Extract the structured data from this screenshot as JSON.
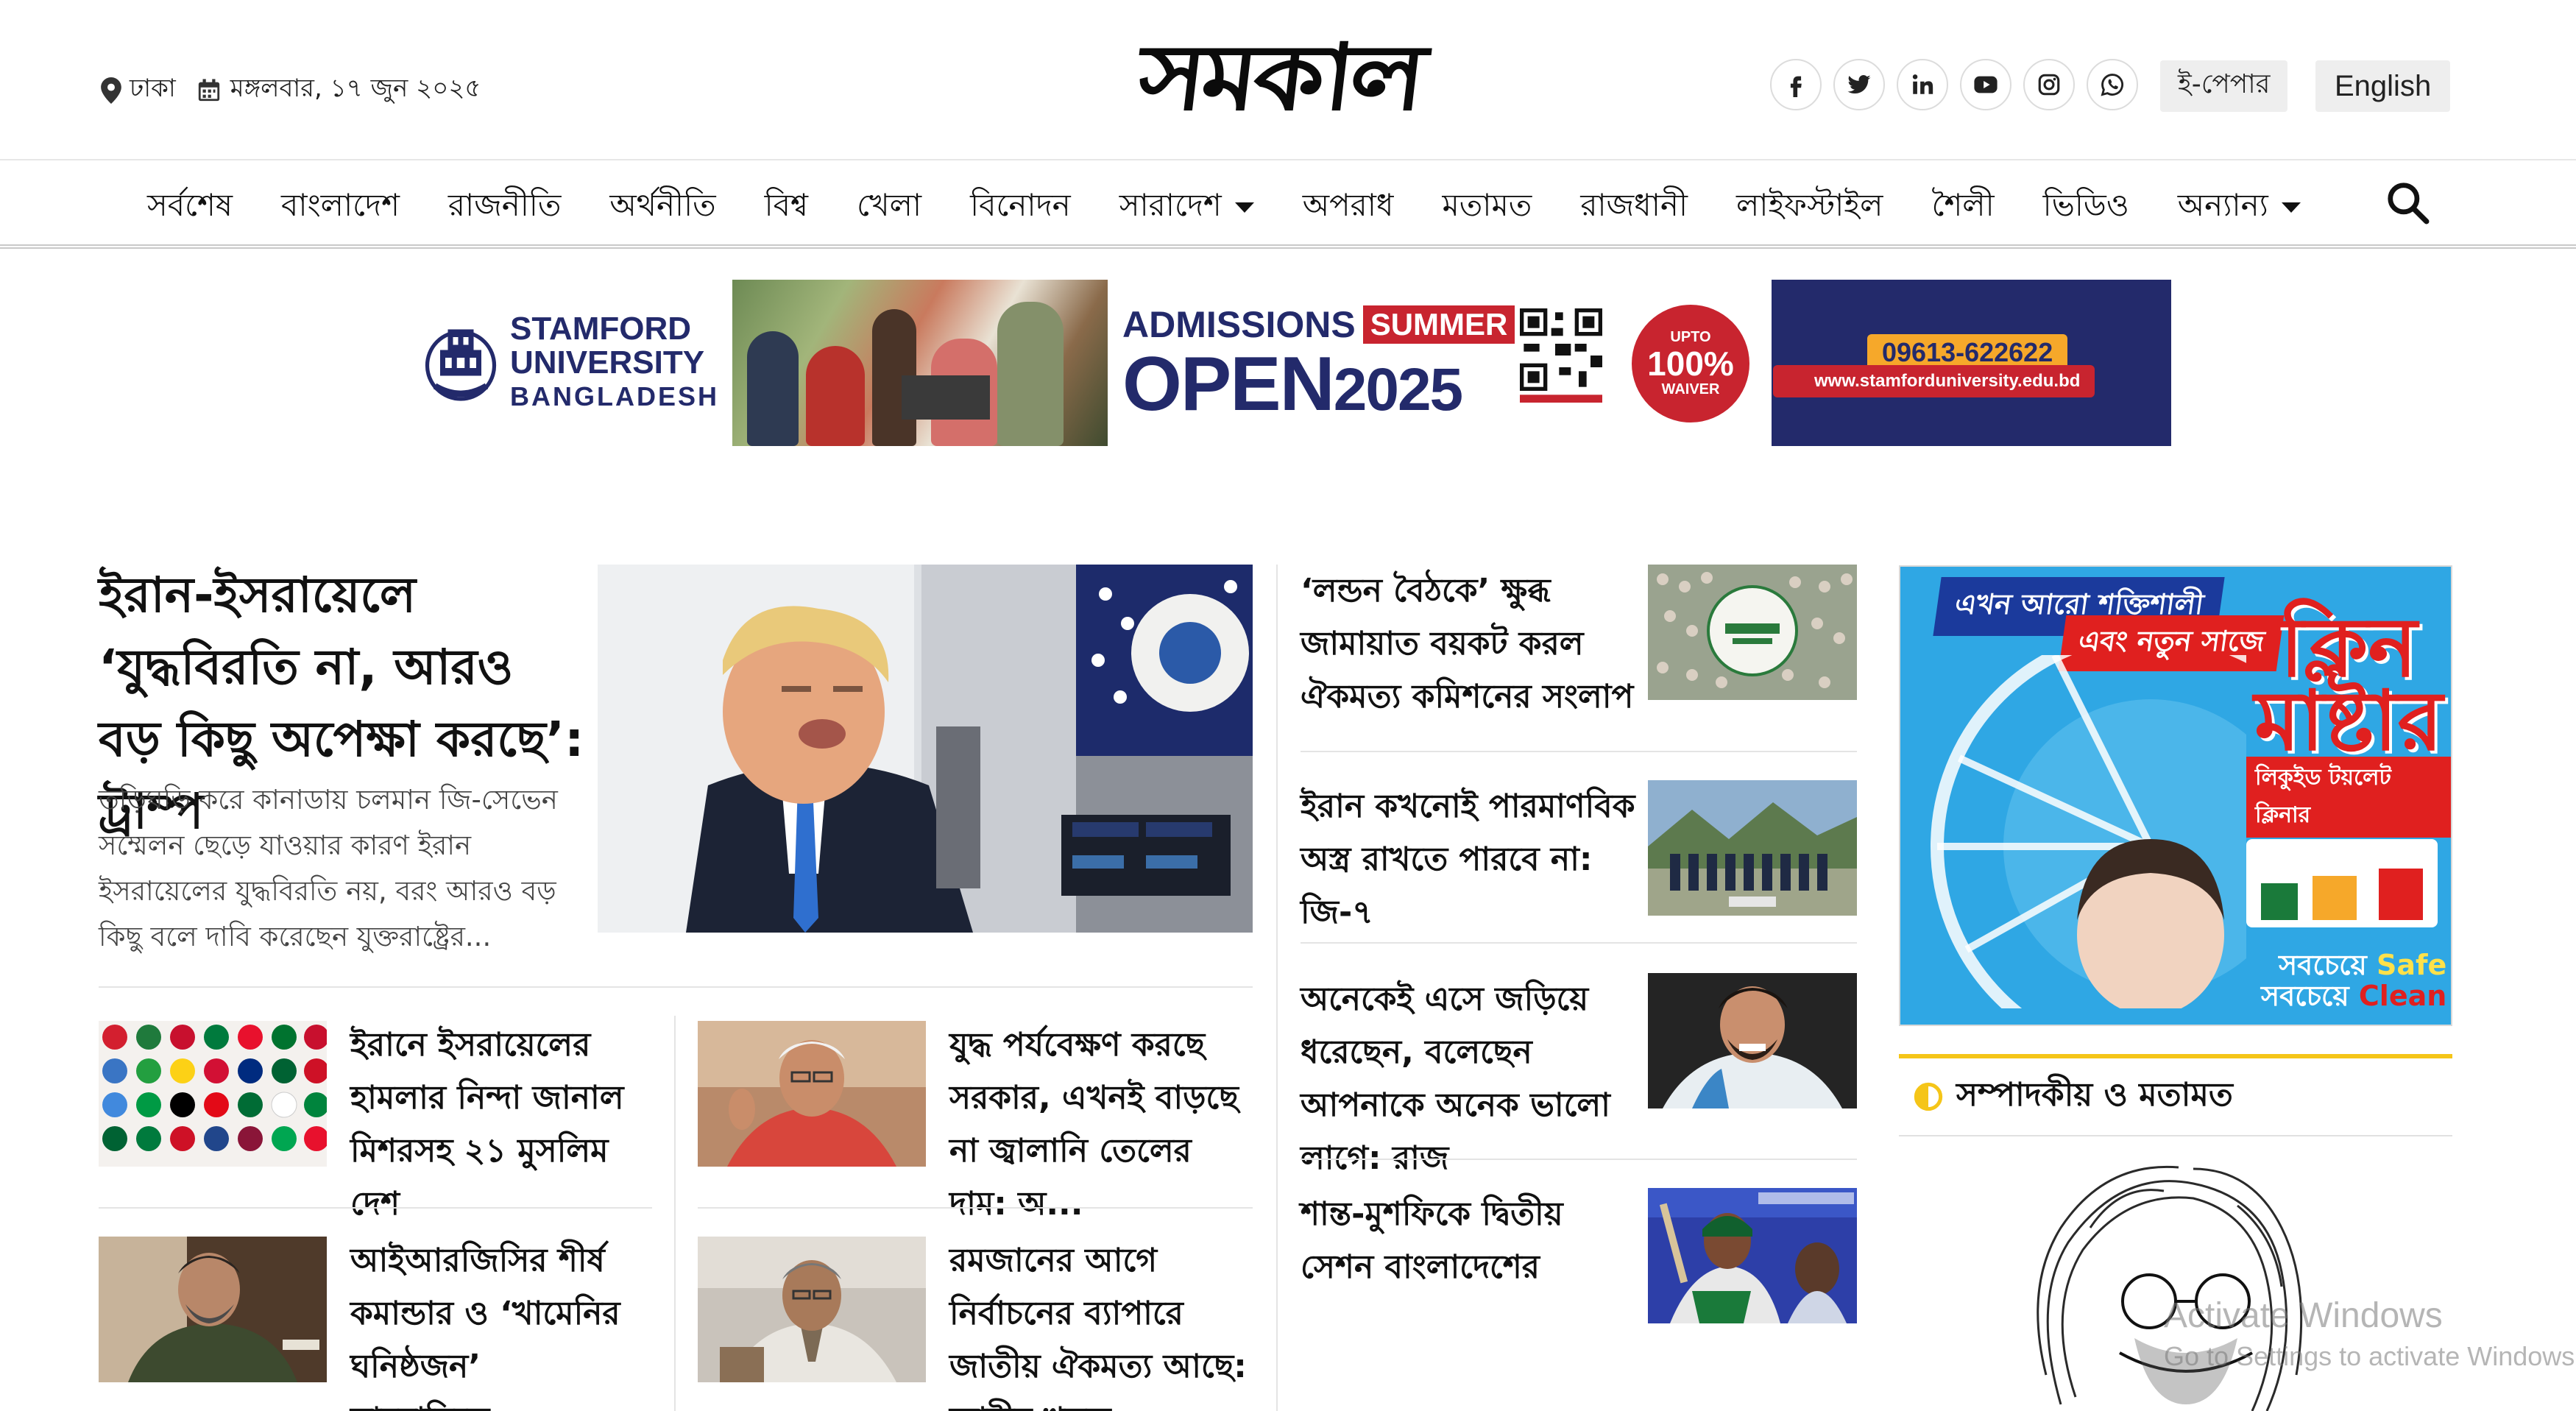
{
  "topbar": {
    "location": "ঢাকা",
    "date": "মঙ্গলবার, ১৭ জুন ২০২৫",
    "logo_text": "সমকাল",
    "social_icons": [
      "facebook-icon",
      "twitter-icon",
      "linkedin-icon",
      "youtube-icon",
      "instagram-icon",
      "whatsapp-icon"
    ],
    "epaper_label": "ই-পেপার",
    "english_label": "English"
  },
  "nav": {
    "items": [
      {
        "label": "সর্বশেষ"
      },
      {
        "label": "বাংলাদেশ"
      },
      {
        "label": "রাজনীতি"
      },
      {
        "label": "অর্থনীতি"
      },
      {
        "label": "বিশ্ব"
      },
      {
        "label": "খেলা"
      },
      {
        "label": "বিনোদন"
      },
      {
        "label": "সারাদেশ"
      },
      {
        "label": "অপরাধ"
      },
      {
        "label": "মতামত"
      },
      {
        "label": "রাজধানী"
      },
      {
        "label": "লাইফস্টাইল"
      },
      {
        "label": "শৈলী"
      },
      {
        "label": "ভিডিও"
      },
      {
        "label": "অন্যান্য"
      }
    ],
    "search_icon": "search-icon"
  },
  "banner_ad": {
    "brand_line1": "STAMFORD",
    "brand_line2": "UNIVERSITY",
    "brand_line3": "BANGLADESH",
    "admissions": "ADMISSIONS",
    "summer": "SUMMER",
    "open": "OPEN",
    "year": "2025",
    "upto": "UPTO",
    "waiver_pct": "100%",
    "waiver": "WAIVER",
    "phone": "09613-622622",
    "website": "www.stamforduniversity.edu.bd",
    "colors": {
      "navy": "#232a6b",
      "red": "#c8242f",
      "orange": "#f6a82a"
    }
  },
  "lead": {
    "title": "ইরান-ইসরায়েলে ‘যুদ্ধবিরতি না, আরও বড় কিছু অপেক্ষা করছে’: ট্রাম্প",
    "summary": "তড়িঘড়ি করে কানাডায় চলমান জি-সেভেন সম্মেলন ছেড়ে যাওয়ার কারণ ইরান ইসরায়েলের যুদ্ধবিরতি নয়, বরং আরও বড় কিছু বলে দাবি করেছেন যুক্তরাষ্ট্রের..."
  },
  "cards": [
    {
      "title": "ইরানে ইসরায়েলের হামলার নিন্দা জানাল মিশরসহ ২১ মুসলিম দেশ"
    },
    {
      "title": "যুদ্ধ পর্যবেক্ষণ করছে সরকার, এখনই বাড়ছে না জ্বালানি তেলের দাম: অ..."
    },
    {
      "title": "আইআরজিসির শীর্ষ কমান্ডার ও ‘খামেনির ঘনিষ্ঠজন’ সাদমানিকে..."
    },
    {
      "title": "রমজানের আগে নির্বাচনের ব্যাপারে জাতীয় ঐকমত্য আছে: আমীর খসরু"
    }
  ],
  "mid_column": [
    {
      "title": "‘লন্ডন বৈঠকে’ ক্ষুব্ধ জামায়াত বয়কট করল ঐকমত্য কমিশনের সংলাপ"
    },
    {
      "title": "ইরান কখনোই পারমাণবিক অস্ত্র রাখতে পারবে না: জি-৭"
    },
    {
      "title": "অনেকেই এসে জড়িয়ে ধরেছেন, বলেছেন আপনাকে অনেক ভালো লাগে: রাজ"
    },
    {
      "title": "শান্ত-মুশফিকে দ্বিতীয় সেশন বাংলাদেশের"
    }
  ],
  "right_ad": {
    "tag1": "এখন আরো শক্তিশালী",
    "tag2": "এবং নতুন সাজে",
    "brand": "ক্লিন মাষ্টার",
    "sub": "লিকুইড টয়লেট ক্লিনার",
    "safe_prefix": "সবচেয়ে",
    "safe": "Safe",
    "clean": "Clean"
  },
  "opinion_section": {
    "title": "সম্পাদকীয় ও মতামত"
  },
  "watermark": {
    "line1": "Activate Windows",
    "line2": "Go to Settings to activate Windows."
  }
}
